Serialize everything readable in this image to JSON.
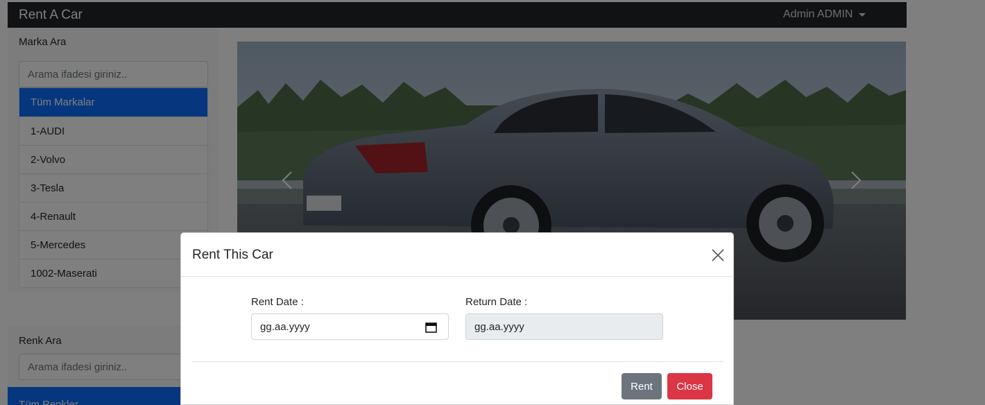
{
  "app": {
    "brand": "Rent A Car",
    "user_menu": "Admin ADMIN"
  },
  "sidebar": {
    "brand_filter": {
      "heading": "Marka Ara",
      "search_placeholder": "Arama ifadesi giriniz..",
      "items": [
        {
          "label": "Tüm Markalar",
          "active": true
        },
        {
          "label": "1-AUDI"
        },
        {
          "label": "2-Volvo"
        },
        {
          "label": "3-Tesla"
        },
        {
          "label": "4-Renault"
        },
        {
          "label": "5-Mercedes"
        },
        {
          "label": "1002-Maserati"
        }
      ]
    },
    "color_filter": {
      "heading": "Renk Ara",
      "search_placeholder": "Arama ifadesi giriniz..",
      "active_item": "Tüm Renkler"
    }
  },
  "carousel": {
    "image": "volvo-s90-sedan"
  },
  "modal": {
    "title": "Rent This Car",
    "rent_date_label": "Rent Date :",
    "rent_date_placeholder": "gg.aa.yyyy",
    "return_date_label": "Return Date :",
    "return_date_placeholder": "gg.aa.yyyy",
    "rent_button": "Rent",
    "close_button": "Close"
  },
  "colors": {
    "navbar": "#212529",
    "primary": "#0d6efd",
    "secondary": "#6c757d",
    "danger": "#dc3545"
  },
  "icons": [
    "caret-down-icon",
    "chevron-left-icon",
    "chevron-right-icon",
    "calendar-icon",
    "close-icon"
  ]
}
